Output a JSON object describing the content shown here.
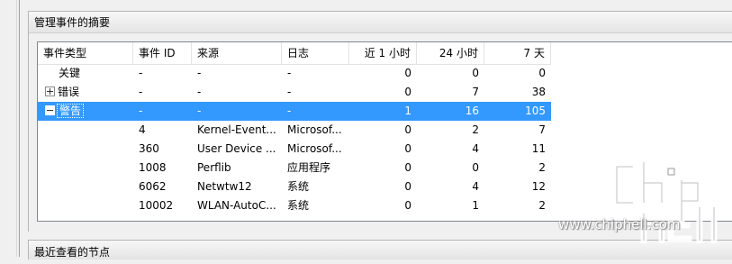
{
  "summary_panel": {
    "title": "管理事件的摘要"
  },
  "columns": [
    "事件类型",
    "事件 ID",
    "来源",
    "日志",
    "近 1 小时",
    "24 小时",
    "7 天"
  ],
  "rows": [
    {
      "type": "关键",
      "expander": "",
      "id": "-",
      "source": "-",
      "log": "-",
      "h1": "0",
      "h24": "0",
      "d7": "0"
    },
    {
      "type": "错误",
      "expander": "plus",
      "id": "-",
      "source": "-",
      "log": "-",
      "h1": "0",
      "h24": "7",
      "d7": "38"
    },
    {
      "type": "警告",
      "expander": "minus",
      "id": "-",
      "source": "-",
      "log": "-",
      "h1": "1",
      "h24": "16",
      "d7": "105",
      "selected": true
    },
    {
      "type": "",
      "expander": "",
      "id": "4",
      "source": "Kernel-Event...",
      "log": "Microsof...",
      "h1": "0",
      "h24": "2",
      "d7": "7"
    },
    {
      "type": "",
      "expander": "",
      "id": "360",
      "source": "User Device ...",
      "log": "Microsof...",
      "h1": "0",
      "h24": "4",
      "d7": "11"
    },
    {
      "type": "",
      "expander": "",
      "id": "1008",
      "source": "Perflib",
      "log": "应用程序",
      "h1": "0",
      "h24": "0",
      "d7": "2"
    },
    {
      "type": "",
      "expander": "",
      "id": "6062",
      "source": "Netwtw12",
      "log": "系统",
      "h1": "0",
      "h24": "4",
      "d7": "12"
    },
    {
      "type": "",
      "expander": "",
      "id": "10002",
      "source": "WLAN-AutoC...",
      "log": "系统",
      "h1": "0",
      "h24": "1",
      "d7": "2"
    }
  ],
  "recent_panel": {
    "title": "最近查看的节点"
  },
  "watermark": {
    "url": "www.chiphell.com",
    "logo_text": "chip hell"
  },
  "colors": {
    "selection": "#3399ff"
  }
}
